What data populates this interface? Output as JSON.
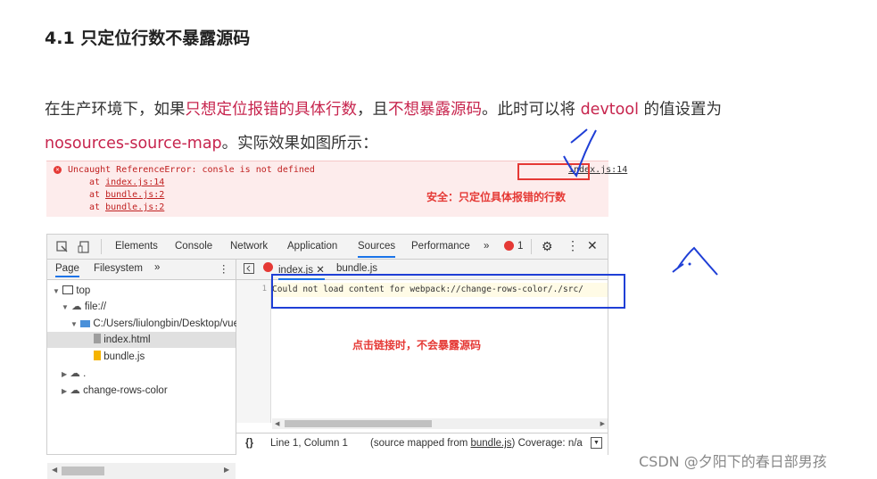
{
  "heading": "4.1 只定位行数不暴露源码",
  "paragraph": {
    "p1": "在生产环境下，如果",
    "h1": "只想定位报错的具体行数",
    "p2": "，且",
    "h2": "不想暴露源码",
    "p3": "。此时可以将 ",
    "h3": "devtool",
    "p4": " 的值设置为",
    "h4": "nosources-source-map",
    "p5": "。实际效果如图所示："
  },
  "console": {
    "error_message": "Uncaught ReferenceError: consle is not defined",
    "stack": [
      {
        "prefix": "at ",
        "file": "index.js:14"
      },
      {
        "prefix": "at ",
        "file": "bundle.js:2"
      },
      {
        "prefix": "at ",
        "file": "bundle.js:2"
      }
    ],
    "source_link": "index.js:14",
    "annotation": "安全：只定位具体报错的行数"
  },
  "devtools": {
    "tabs": [
      "Elements",
      "Console",
      "Network",
      "Application",
      "Sources",
      "Performance"
    ],
    "active_tab": "Sources",
    "more": "»",
    "error_count": "1",
    "sidebar_tabs": [
      "Page",
      "Filesystem"
    ],
    "sidebar_more": "»",
    "tree": [
      {
        "label": "top"
      },
      {
        "label": "file://"
      },
      {
        "label": "C:/Users/liulongbin/Desktop/vue"
      },
      {
        "label": "index.html"
      },
      {
        "label": "bundle.js"
      },
      {
        "label": "."
      },
      {
        "label": "change-rows-color"
      }
    ],
    "editor_tabs": [
      "index.js",
      "bundle.js"
    ],
    "line_number": "1",
    "code": "Could not load content for webpack://change-rows-color/./src/",
    "status": {
      "braces": "{}",
      "position": "Line 1, Column 1",
      "mapped_prefix": "(source mapped from ",
      "mapped_file": "bundle.js",
      "mapped_suffix": ") Coverage: n/a"
    },
    "annotation": "点击链接时，不会暴露源码"
  },
  "watermark": "CSDN @夕阳下的春日部男孩",
  "colors": {
    "highlight": "#c7254e",
    "annotation_red": "#e53935",
    "box_blue": "#1f3fd6"
  }
}
